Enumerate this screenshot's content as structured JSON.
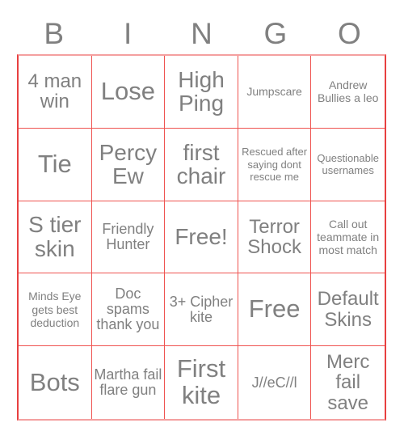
{
  "card": {
    "title_letters": [
      "B",
      "I",
      "N",
      "G",
      "O"
    ],
    "accent_color": "#ef5350",
    "text_color": "#808080",
    "background_color": "#ffffff",
    "rows": 5,
    "columns": 5,
    "cells": [
      {
        "text": "4 man win",
        "size": "fs-md"
      },
      {
        "text": "Lose",
        "size": "fs-xl"
      },
      {
        "text": "High Ping",
        "size": "fs-lg"
      },
      {
        "text": "Jumpscare",
        "size": "fs-xs"
      },
      {
        "text": "Andrew Bullies a leo",
        "size": "fs-xs"
      },
      {
        "text": "Tie",
        "size": "fs-xl"
      },
      {
        "text": "Percy Ew",
        "size": "fs-lg"
      },
      {
        "text": "first chair",
        "size": "fs-lg"
      },
      {
        "text": "Rescued after saying dont rescue me",
        "size": "fs-xxs"
      },
      {
        "text": "Questionable usernames",
        "size": "fs-xxs"
      },
      {
        "text": "S tier skin",
        "size": "fs-lg"
      },
      {
        "text": "Friendly Hunter",
        "size": "fs-sm"
      },
      {
        "text": "Free!",
        "size": "fs-lg"
      },
      {
        "text": "Terror Shock",
        "size": "fs-md"
      },
      {
        "text": "Call out teammate in most match",
        "size": "fs-xs"
      },
      {
        "text": "Minds Eye gets best deduction",
        "size": "fs-xs"
      },
      {
        "text": "Doc spams thank you",
        "size": "fs-sm"
      },
      {
        "text": "3+ Cipher kite",
        "size": "fs-sm"
      },
      {
        "text": "Free",
        "size": "fs-xl"
      },
      {
        "text": "Default Skins",
        "size": "fs-md"
      },
      {
        "text": "Bots",
        "size": "fs-xl"
      },
      {
        "text": "Martha fail flare gun",
        "size": "fs-sm"
      },
      {
        "text": "First kite",
        "size": "fs-xl"
      },
      {
        "text": "J//eC//l",
        "size": "fs-sm"
      },
      {
        "text": "Merc fail save",
        "size": "fs-md"
      }
    ]
  }
}
